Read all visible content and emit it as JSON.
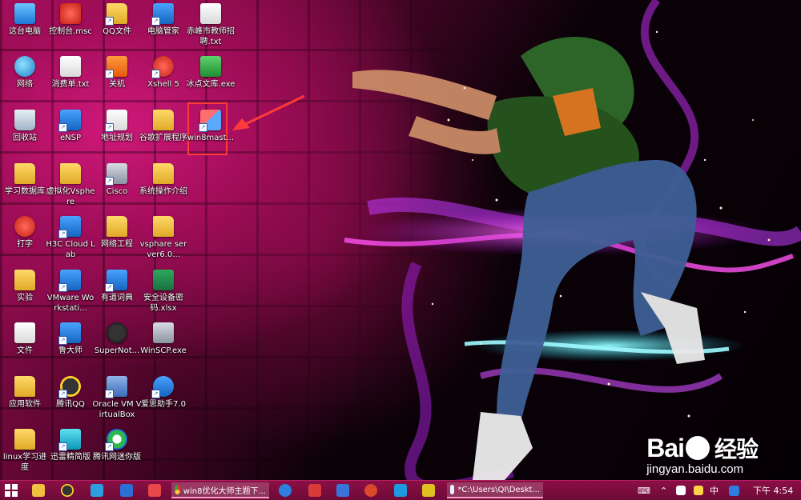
{
  "desktop": {
    "icons": [
      {
        "label": "这台电脑",
        "icon": "this-pc-icon"
      },
      {
        "label": "控制台.msc",
        "icon": "console-file-icon"
      },
      {
        "label": "QQ文件",
        "icon": "folder-icon"
      },
      {
        "label": "电脑管家",
        "icon": "pc-manager-icon"
      },
      {
        "label": "赤峰市教师招聘.txt",
        "icon": "text-file-icon"
      },
      {
        "label": "网络",
        "icon": "network-icon"
      },
      {
        "label": "消费单.txt",
        "icon": "text-file-icon"
      },
      {
        "label": "关机",
        "icon": "power-icon"
      },
      {
        "label": "Xshell 5",
        "icon": "xshell-icon"
      },
      {
        "label": "冰点文库.exe",
        "icon": "app-exe-icon"
      },
      {
        "label": "回收站",
        "icon": "recycle-bin-icon"
      },
      {
        "label": "eNSP",
        "icon": "ensp-icon"
      },
      {
        "label": "地址规划",
        "icon": "document-icon"
      },
      {
        "label": "谷歌扩展程序",
        "icon": "folder-icon"
      },
      {
        "label": "win8mast...",
        "icon": "setup-shortcut-icon"
      },
      {
        "label": "学习数据库",
        "icon": "folder-icon"
      },
      {
        "label": "虚拟化Vsphere",
        "icon": "folder-icon"
      },
      {
        "label": "Cisco",
        "icon": "cisco-icon"
      },
      {
        "label": "系统操作介绍",
        "icon": "folder-icon"
      },
      {
        "label": "打字",
        "icon": "typing-app-icon"
      },
      {
        "label": "H3C Cloud Lab",
        "icon": "h3c-icon"
      },
      {
        "label": "网络工程",
        "icon": "folder-icon"
      },
      {
        "label": "vsphare server6.0...",
        "icon": "folder-icon"
      },
      {
        "label": "实验",
        "icon": "folder-icon"
      },
      {
        "label": "VMware Workstati...",
        "icon": "vmware-icon"
      },
      {
        "label": "有道词典",
        "icon": "youdao-icon"
      },
      {
        "label": "安全设备密码.xlsx",
        "icon": "excel-file-icon"
      },
      {
        "label": "文件",
        "icon": "folder-icon"
      },
      {
        "label": "鲁大师",
        "icon": "ludashi-icon"
      },
      {
        "label": "SuperNot...",
        "icon": "supernote-icon"
      },
      {
        "label": "WinSCP.exe",
        "icon": "winscp-icon"
      },
      {
        "label": "应用软件",
        "icon": "folder-icon"
      },
      {
        "label": "腾讯QQ",
        "icon": "qq-icon"
      },
      {
        "label": "Oracle VM VirtualBox",
        "icon": "virtualbox-icon"
      },
      {
        "label": "爱思助手7.0",
        "icon": "i4-assistant-icon"
      },
      {
        "label": "linux学习进度",
        "icon": "folder-icon"
      },
      {
        "label": "迅雷精简版",
        "icon": "thunder-icon"
      },
      {
        "label": "腾讯网迷你版",
        "icon": "tencent-mini-icon"
      }
    ]
  },
  "watermark": {
    "brand_left": "Bai",
    "brand_right": "经验",
    "url": "jingyan.baidu.com"
  },
  "taskbar": {
    "start_icon": "windows-start-icon",
    "tasks": [
      {
        "label": "win8优化大师主题下...",
        "icon": "chrome-icon"
      },
      {
        "label": "*C:\\Users\\QI\\Deskt...",
        "icon": "notepad-icon"
      }
    ],
    "tray": {
      "ime": "中",
      "clock": "下午 4:54"
    }
  },
  "colors": {
    "taskbar": "#7c0c3f",
    "highlight": "#ff3a3a",
    "accent": "#d0187a"
  }
}
